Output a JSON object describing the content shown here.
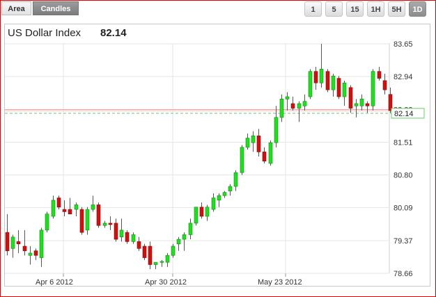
{
  "chart_type_tabs": [
    {
      "label": "Area",
      "active": false
    },
    {
      "label": "Candles",
      "active": true
    }
  ],
  "timeframes": [
    {
      "label": "1",
      "active": false
    },
    {
      "label": "5",
      "active": false
    },
    {
      "label": "15",
      "active": false
    },
    {
      "label": "1H",
      "active": false
    },
    {
      "label": "5H",
      "active": false
    },
    {
      "label": "1D",
      "active": true
    }
  ],
  "header": {
    "symbol": "US Dollar Index",
    "last_value": "82.14"
  },
  "colors": {
    "up": "#22dd22",
    "down": "#cc1111",
    "reference_line": "#ff8c8c",
    "current_line": "#66cc66",
    "grid": "#e6e6e6"
  },
  "chart_data": {
    "type": "candlestick",
    "title": "US Dollar Index",
    "last_price": 82.14,
    "reference_price": 82.22,
    "y_ticks": [
      "83.65",
      "82.94",
      "82.22",
      "81.51",
      "80.80",
      "80.09",
      "79.37",
      "78.66"
    ],
    "ylim": [
      78.66,
      83.65
    ],
    "x_ticks": [
      "Apr 6 2012",
      "Apr 30 2012",
      "May 23 2012"
    ],
    "grid": true,
    "candles": [
      {
        "o": 79.55,
        "h": 79.95,
        "l": 79.05,
        "c": 79.15
      },
      {
        "o": 79.2,
        "h": 79.5,
        "l": 79.0,
        "c": 79.45
      },
      {
        "o": 79.35,
        "h": 79.6,
        "l": 79.1,
        "c": 79.3
      },
      {
        "o": 79.25,
        "h": 79.6,
        "l": 79.05,
        "c": 79.15
      },
      {
        "o": 79.05,
        "h": 79.25,
        "l": 78.85,
        "c": 79.1
      },
      {
        "o": 79.15,
        "h": 79.2,
        "l": 78.95,
        "c": 79.05
      },
      {
        "o": 79.0,
        "h": 79.65,
        "l": 78.8,
        "c": 79.6
      },
      {
        "o": 79.6,
        "h": 80.0,
        "l": 79.55,
        "c": 79.95
      },
      {
        "o": 79.9,
        "h": 80.35,
        "l": 79.85,
        "c": 80.25
      },
      {
        "o": 80.3,
        "h": 80.35,
        "l": 80.05,
        "c": 80.1
      },
      {
        "o": 80.05,
        "h": 80.25,
        "l": 79.9,
        "c": 80.0
      },
      {
        "o": 80.05,
        "h": 80.3,
        "l": 79.95,
        "c": 79.95
      },
      {
        "o": 80.05,
        "h": 80.2,
        "l": 79.9,
        "c": 80.15
      },
      {
        "o": 80.05,
        "h": 80.1,
        "l": 79.5,
        "c": 79.55
      },
      {
        "o": 79.6,
        "h": 80.1,
        "l": 79.5,
        "c": 80.05
      },
      {
        "o": 80.05,
        "h": 80.35,
        "l": 80.0,
        "c": 80.15
      },
      {
        "o": 80.15,
        "h": 80.2,
        "l": 79.65,
        "c": 79.7
      },
      {
        "o": 79.7,
        "h": 79.8,
        "l": 79.65,
        "c": 79.75
      },
      {
        "o": 79.75,
        "h": 79.9,
        "l": 79.6,
        "c": 79.72
      },
      {
        "o": 79.75,
        "h": 79.85,
        "l": 79.35,
        "c": 79.4
      },
      {
        "o": 79.45,
        "h": 79.85,
        "l": 79.35,
        "c": 79.6
      },
      {
        "o": 79.55,
        "h": 79.6,
        "l": 79.3,
        "c": 79.35
      },
      {
        "o": 79.35,
        "h": 79.55,
        "l": 79.3,
        "c": 79.5
      },
      {
        "o": 79.35,
        "h": 79.45,
        "l": 79.15,
        "c": 79.2
      },
      {
        "o": 79.25,
        "h": 79.3,
        "l": 78.95,
        "c": 79.0
      },
      {
        "o": 79.25,
        "h": 79.35,
        "l": 78.75,
        "c": 78.85
      },
      {
        "o": 78.85,
        "h": 78.9,
        "l": 78.75,
        "c": 78.9
      },
      {
        "o": 78.9,
        "h": 78.95,
        "l": 78.8,
        "c": 78.92
      },
      {
        "o": 78.9,
        "h": 79.1,
        "l": 78.8,
        "c": 79.05
      },
      {
        "o": 79.05,
        "h": 79.3,
        "l": 79.0,
        "c": 79.25
      },
      {
        "o": 79.3,
        "h": 79.45,
        "l": 79.15,
        "c": 79.4
      },
      {
        "o": 79.4,
        "h": 79.55,
        "l": 79.15,
        "c": 79.5
      },
      {
        "o": 79.5,
        "h": 79.85,
        "l": 79.4,
        "c": 79.75
      },
      {
        "o": 79.75,
        "h": 80.1,
        "l": 79.7,
        "c": 80.1
      },
      {
        "o": 80.1,
        "h": 80.2,
        "l": 79.85,
        "c": 79.9
      },
      {
        "o": 79.9,
        "h": 80.15,
        "l": 79.8,
        "c": 80.1
      },
      {
        "o": 80.05,
        "h": 80.4,
        "l": 80.0,
        "c": 80.3
      },
      {
        "o": 80.25,
        "h": 80.4,
        "l": 80.1,
        "c": 80.35
      },
      {
        "o": 80.35,
        "h": 80.45,
        "l": 80.3,
        "c": 80.42
      },
      {
        "o": 80.45,
        "h": 80.6,
        "l": 80.35,
        "c": 80.55
      },
      {
        "o": 80.55,
        "h": 80.9,
        "l": 80.45,
        "c": 80.85
      },
      {
        "o": 80.85,
        "h": 81.45,
        "l": 80.8,
        "c": 81.4
      },
      {
        "o": 81.4,
        "h": 81.7,
        "l": 81.35,
        "c": 81.6
      },
      {
        "o": 81.5,
        "h": 81.75,
        "l": 81.3,
        "c": 81.65
      },
      {
        "o": 81.65,
        "h": 81.8,
        "l": 81.2,
        "c": 81.3
      },
      {
        "o": 81.3,
        "h": 81.4,
        "l": 81.05,
        "c": 81.1
      },
      {
        "o": 81.05,
        "h": 81.55,
        "l": 81.0,
        "c": 81.5
      },
      {
        "o": 81.5,
        "h": 82.3,
        "l": 81.4,
        "c": 82.05
      },
      {
        "o": 82.05,
        "h": 82.55,
        "l": 81.95,
        "c": 82.45
      },
      {
        "o": 82.45,
        "h": 82.6,
        "l": 82.2,
        "c": 82.5
      },
      {
        "o": 82.35,
        "h": 82.5,
        "l": 82.2,
        "c": 82.25
      },
      {
        "o": 82.25,
        "h": 82.4,
        "l": 81.95,
        "c": 82.35
      },
      {
        "o": 82.3,
        "h": 82.55,
        "l": 82.2,
        "c": 82.4
      },
      {
        "o": 82.5,
        "h": 83.1,
        "l": 82.45,
        "c": 83.05
      },
      {
        "o": 83.05,
        "h": 83.15,
        "l": 82.65,
        "c": 82.8
      },
      {
        "o": 82.8,
        "h": 83.65,
        "l": 82.7,
        "c": 83.1
      },
      {
        "o": 83.05,
        "h": 83.1,
        "l": 82.6,
        "c": 82.65
      },
      {
        "o": 82.65,
        "h": 83.0,
        "l": 82.5,
        "c": 82.95
      },
      {
        "o": 82.9,
        "h": 82.95,
        "l": 82.45,
        "c": 82.5
      },
      {
        "o": 82.5,
        "h": 82.85,
        "l": 82.3,
        "c": 82.8
      },
      {
        "o": 82.7,
        "h": 82.75,
        "l": 82.15,
        "c": 82.25
      },
      {
        "o": 82.3,
        "h": 82.45,
        "l": 82.05,
        "c": 82.35
      },
      {
        "o": 82.3,
        "h": 82.55,
        "l": 82.2,
        "c": 82.45
      },
      {
        "o": 82.35,
        "h": 82.4,
        "l": 82.15,
        "c": 82.3
      },
      {
        "o": 82.3,
        "h": 83.1,
        "l": 82.2,
        "c": 83.05
      },
      {
        "o": 83.05,
        "h": 83.15,
        "l": 82.85,
        "c": 82.9
      },
      {
        "o": 82.85,
        "h": 83.0,
        "l": 82.55,
        "c": 82.65
      },
      {
        "o": 82.55,
        "h": 82.7,
        "l": 82.15,
        "c": 82.2
      }
    ]
  }
}
